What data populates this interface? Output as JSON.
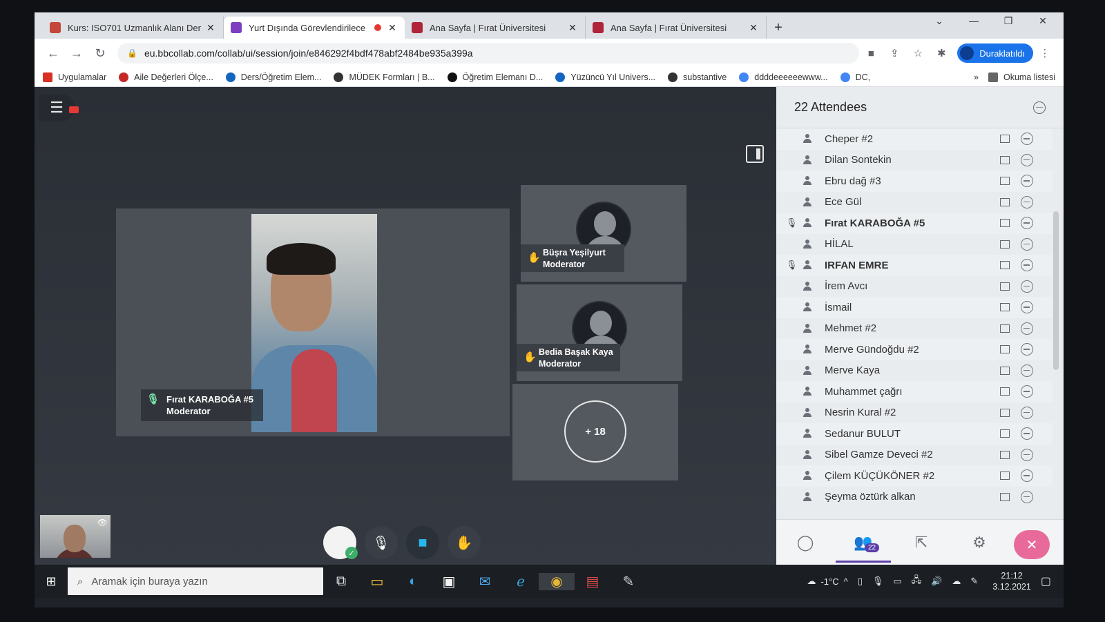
{
  "tabs": [
    {
      "title": "Kurs: ISO701 Uzmanlık Alanı Der",
      "favicon_color": "#c4473a",
      "active": false
    },
    {
      "title": "Yurt Dışında Görevlendirilece",
      "favicon_color": "#7b3fbf",
      "active": true,
      "recording": true
    },
    {
      "title": "Ana Sayfa | Fırat Üniversitesi",
      "favicon_color": "#b0243a",
      "active": false
    },
    {
      "title": "Ana Sayfa | Fırat Üniversitesi",
      "favicon_color": "#b0243a",
      "active": false
    }
  ],
  "window": {
    "newtab": "+",
    "expand": "⌄",
    "minimize": "—",
    "restore": "❐",
    "close": "✕"
  },
  "address": {
    "url": "eu.bbcollab.com/collab/ui/session/join/e846292f4bdf478abf2484be935a399a",
    "profile_label": "Duraklatıldı"
  },
  "bookmarks": [
    {
      "label": "Uygulamalar",
      "icon_color": "#d93025"
    },
    {
      "label": "Aile Değerleri Ölçe...",
      "icon_color": "#c62828"
    },
    {
      "label": "Ders/Öğretim Elem...",
      "icon_color": "#1565c0"
    },
    {
      "label": "MÜDEK Formları | B...",
      "icon_color": "#333333"
    },
    {
      "label": "Öğretim Elemanı D...",
      "icon_color": "#111111"
    },
    {
      "label": "Yüzüncü Yıl Univers...",
      "icon_color": "#1565c0"
    },
    {
      "label": "substantive",
      "icon_color": "#333333"
    },
    {
      "label": "ddddeeeeeewww...",
      "icon_color": "#4285f4"
    },
    {
      "label": "DC,",
      "icon_color": "#4285f4"
    }
  ],
  "bookmarks_more": "»",
  "reading_list": "Okuma listesi",
  "stage": {
    "presenter_name": "Fırat KARABOĞA #5",
    "presenter_role": "Moderator",
    "tiles": [
      {
        "name": "Büşra Yeşilyurt",
        "role": "Moderator"
      },
      {
        "name": "Bedia Başak Kaya",
        "role": "Moderator"
      }
    ],
    "more_count": "+ 18"
  },
  "panel": {
    "title": "22 Attendees",
    "attendees": [
      {
        "name": "Cheper #2",
        "mic": false
      },
      {
        "name": "Dilan Sontekin",
        "mic": false
      },
      {
        "name": "Ebru dağ #3",
        "mic": false
      },
      {
        "name": "Ece Gül",
        "mic": false
      },
      {
        "name": "Fırat KARABOĞA #5",
        "mic": true
      },
      {
        "name": "HİLAL",
        "mic": false
      },
      {
        "name": "IRFAN EMRE",
        "mic": true
      },
      {
        "name": "İrem Avcı",
        "mic": false
      },
      {
        "name": "İsmail",
        "mic": false
      },
      {
        "name": "Mehmet #2",
        "mic": false
      },
      {
        "name": "Merve Gündoğdu #2",
        "mic": false
      },
      {
        "name": "Merve Kaya",
        "mic": false
      },
      {
        "name": "Muhammet çağrı",
        "mic": false
      },
      {
        "name": "Nesrin Kural #2",
        "mic": false
      },
      {
        "name": "Sedanur BULUT",
        "mic": false
      },
      {
        "name": "Sibel Gamze Deveci #2",
        "mic": false
      },
      {
        "name": "Çilem KÜÇÜKÖNER #2",
        "mic": false
      },
      {
        "name": "Şeyma öztürk alkan",
        "mic": false
      }
    ],
    "attendee_badge": "22"
  },
  "taskbar": {
    "search_placeholder": "Aramak için buraya yazın",
    "temperature": "-1°C",
    "time": "21:12",
    "date": "3.12.2021"
  }
}
